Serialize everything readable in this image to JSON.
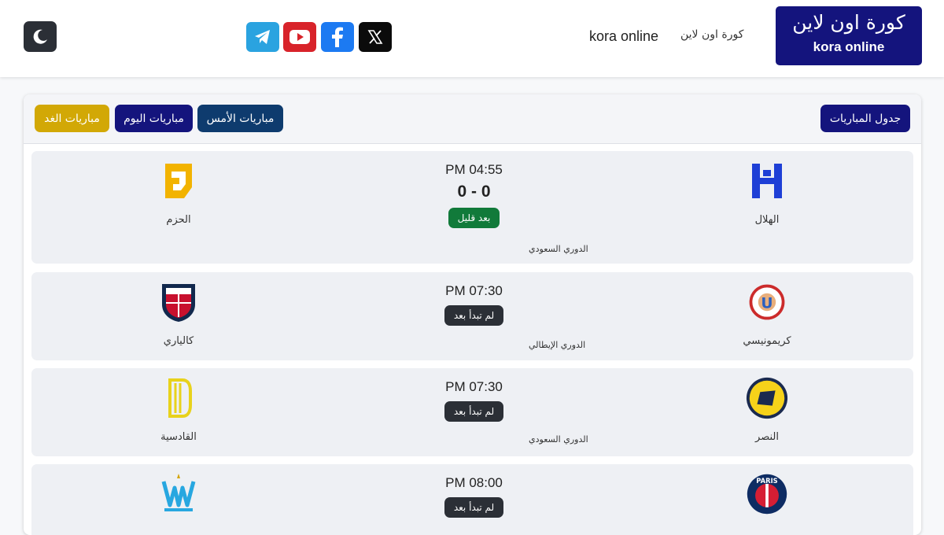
{
  "header": {
    "logo_ar": "كورة اون لاين",
    "logo_en": "kora online",
    "nav_ar": "كورة اون لاين",
    "nav_en": "kora online",
    "social": [
      "telegram-icon",
      "youtube-icon",
      "facebook-icon",
      "x-icon"
    ],
    "theme_toggle": "moon-icon"
  },
  "toolbar": {
    "schedule": "جدول المباريات",
    "yesterday": "مباريات الأمس",
    "today": "مباريات اليوم",
    "tomorrow": "مباريات الغد"
  },
  "matches": [
    {
      "home": "الهلال",
      "away": "الحزم",
      "time": "PM 04:55",
      "score": "0 - 0",
      "status": "بعد قليل",
      "league": "الدوري السعودي"
    },
    {
      "home": "كريمونيسي",
      "away": "كالياري",
      "time": "PM 07:30",
      "status": "لم تبدأ بعد",
      "league": "الدوري الإيطالي"
    },
    {
      "home": "النصر",
      "away": "القادسية",
      "time": "PM 07:30",
      "status": "لم تبدأ بعد",
      "league": "الدوري السعودي"
    },
    {
      "home": "",
      "away": "",
      "time": "PM 08:00",
      "status": "لم تبدأ بعد",
      "league": ""
    }
  ],
  "colors": {
    "brand": "#14147d",
    "live": "#117a3a",
    "pending": "#2b2f36",
    "tomorrow": "#d2a806"
  }
}
